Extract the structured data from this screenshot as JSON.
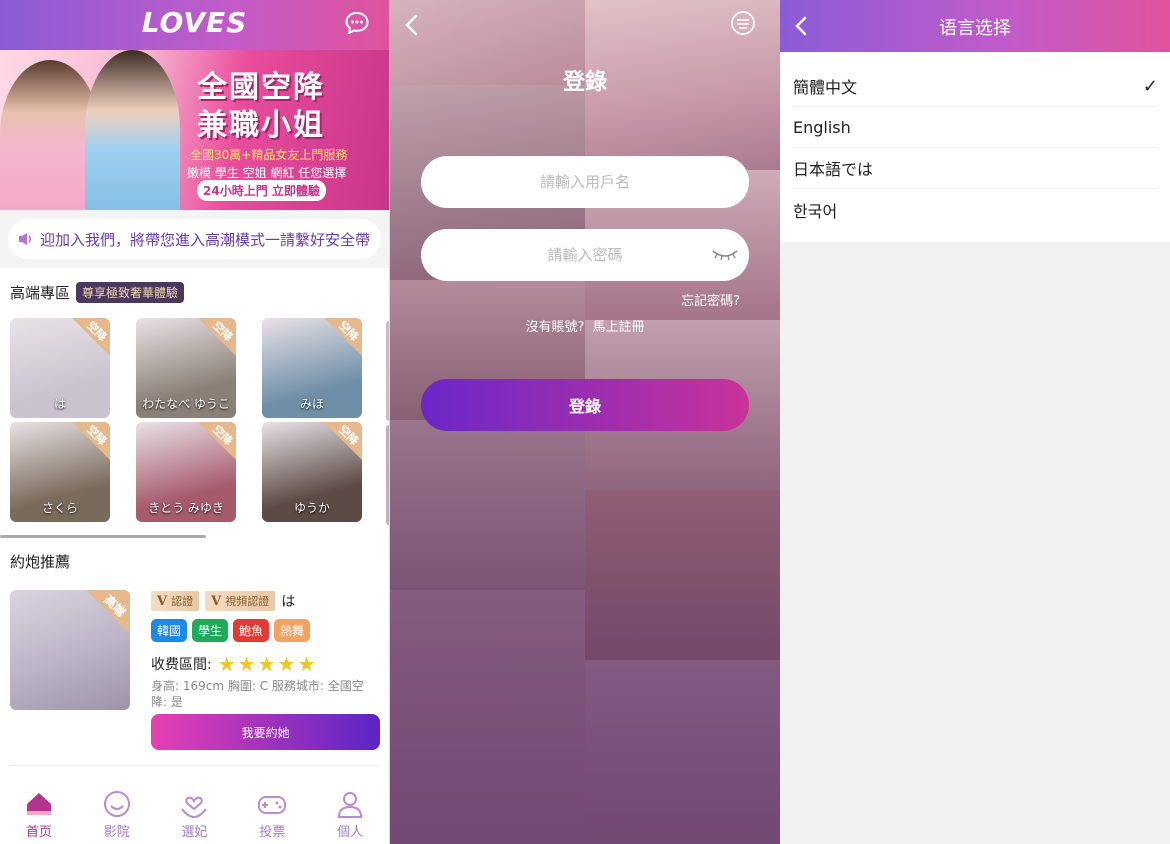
{
  "home": {
    "logo": "LOVES",
    "banner": {
      "line1": "全國空降",
      "line2": "兼職小姐",
      "line3": "全國30萬+精品女友上門服務",
      "line4": "嫩模 學生 空姐 網紅 任您選擇",
      "line5": "24小時上門 立即體驗"
    },
    "notice": "迎加入我們，將帶您進入高潮模式一請繫好安全帶",
    "premium": {
      "title": "高端專區",
      "tag": "尊享極致奢華體驗",
      "corner": "空降",
      "cards": [
        {
          "name": "は",
          "color": "#c9c3cf"
        },
        {
          "name": "わたなべ ゆうこ",
          "color": "#8b8077"
        },
        {
          "name": "みほ",
          "color": "#6f8fa8"
        },
        {
          "name": "さくら",
          "color": "#7a6a5b"
        },
        {
          "name": "きとう みゆき",
          "color": "#a65a6e"
        },
        {
          "name": "ゆうか",
          "color": "#5b4a45"
        }
      ]
    },
    "recommend": {
      "title": "約炮推薦",
      "corner": "高端",
      "badge1": "認證",
      "badge2": "視頻認證",
      "name": "は",
      "tags": [
        {
          "label": "韓國",
          "color": "#1e88e5"
        },
        {
          "label": "學生",
          "color": "#1faa59"
        },
        {
          "label": "鮑魚",
          "color": "#e53935"
        },
        {
          "label": "熱舞",
          "color": "#f4a261"
        }
      ],
      "price_label": "收费區間:",
      "stars": 5,
      "info": "身高: 169cm 胸圍: C 服務城市: 全國空降: 是",
      "button": "我要約她"
    },
    "tabs": [
      {
        "label": "首页",
        "icon": "home-icon",
        "active": true
      },
      {
        "label": "影院",
        "icon": "smile-icon",
        "active": false
      },
      {
        "label": "選妃",
        "icon": "heart-hand-icon",
        "active": false
      },
      {
        "label": "投票",
        "icon": "gamepad-icon",
        "active": false
      },
      {
        "label": "個人",
        "icon": "user-icon",
        "active": false
      }
    ]
  },
  "login": {
    "title": "登錄",
    "username_placeholder": "請輸入用戶名",
    "password_placeholder": "請輸入密碼",
    "forgot": "忘記密碼?",
    "no_account": "沒有賬號?",
    "register": "馬上註冊",
    "button": "登錄"
  },
  "language": {
    "title": "语言选择",
    "options": [
      {
        "label": "簡體中文",
        "selected": true
      },
      {
        "label": "English",
        "selected": false
      },
      {
        "label": "日本語では",
        "selected": false
      },
      {
        "label": "한국어",
        "selected": false
      }
    ],
    "check": "✓"
  }
}
